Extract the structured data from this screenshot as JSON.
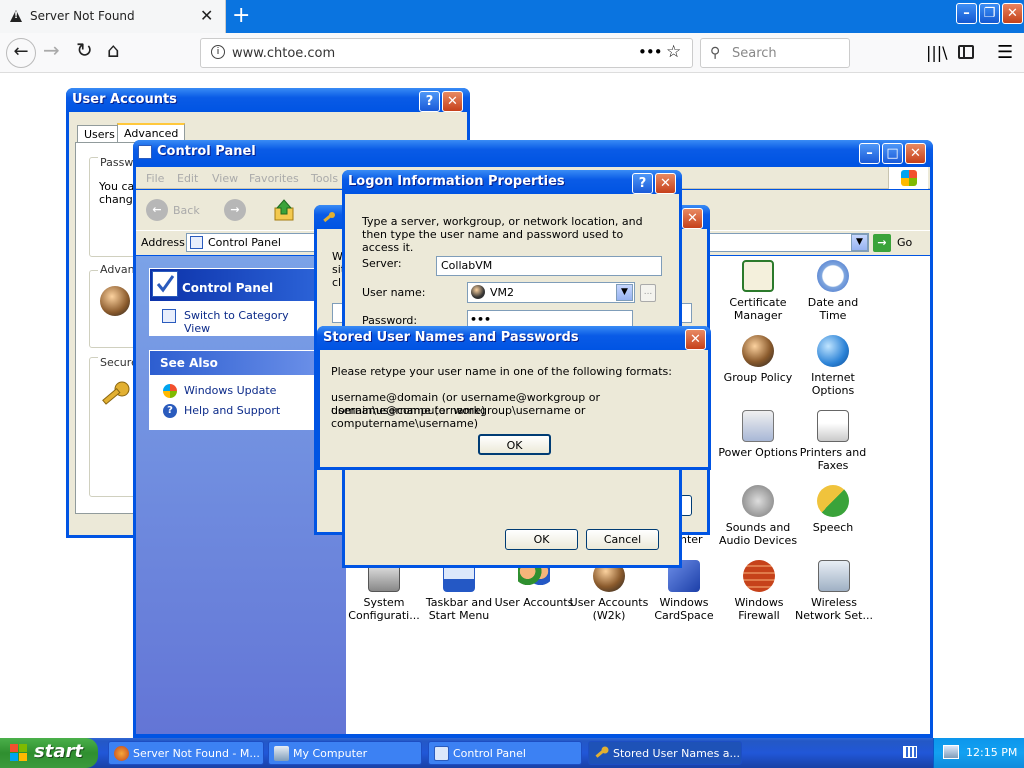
{
  "browser": {
    "tab_title": "Server Not Found",
    "tab_close": "✕",
    "new_tab": "+",
    "url": "www.chtoe.com",
    "search_placeholder": "Search",
    "page_actions": "•••",
    "bookmark_star": "☆",
    "window_min": "–",
    "window_max": "❐",
    "window_close": "✕"
  },
  "user_accounts": {
    "title": "User Accounts",
    "help": "?",
    "close": "✕",
    "tabs": [
      "Users",
      "Advanced"
    ],
    "passwords_group": "Passwo",
    "passwords_text_1": "You ca",
    "passwords_text_2": "change",
    "advanced_group": "Advanc",
    "secure_group": "Secure"
  },
  "control_panel": {
    "title": "Control Panel",
    "menu": [
      "File",
      "Edit",
      "View",
      "Favorites",
      "Tools"
    ],
    "back_label": "Back",
    "address_label": "Address",
    "address_value": "Control Panel",
    "go_label": "Go",
    "panel_title": "Control Panel",
    "switch_view": "Switch to Category View",
    "see_also": "See Also",
    "see_also_items": [
      "Windows Update",
      "Help and Support"
    ],
    "items": [
      {
        "label": "Certificate Manager",
        "icon": "certificate-icon"
      },
      {
        "label": "Date and Time",
        "icon": "clock-icon"
      },
      {
        "label": "Group Policy",
        "icon": "group-policy-icon"
      },
      {
        "label": "Internet Options",
        "icon": "globe-icon"
      },
      {
        "label": "Power Options",
        "icon": "power-icon"
      },
      {
        "label": "Printers and Faxes",
        "icon": "printer-icon"
      },
      {
        "label": "Sounds and Audio Devices",
        "icon": "speaker-icon"
      },
      {
        "label": "Speech",
        "icon": "speech-icon"
      },
      {
        "label": "System Configurati...",
        "icon": "system-icon"
      },
      {
        "label": "Taskbar and Start Menu",
        "icon": "taskbar-icon"
      },
      {
        "label": "User Accounts",
        "icon": "users-icon"
      },
      {
        "label": "User Accounts (W2k)",
        "icon": "users-key-icon"
      },
      {
        "label": "Windows CardSpace",
        "icon": "cardspace-icon"
      },
      {
        "label": "Windows Firewall",
        "icon": "firewall-icon"
      },
      {
        "label": "Wireless Network Set...",
        "icon": "wireless-icon"
      }
    ],
    "partial_text_en": "en",
    "partial_text_nter": "nter",
    "partial_text_w": "W",
    "partial_text_si": "sit",
    "partial_text_cl": "cli"
  },
  "logon": {
    "title": "Logon Information Properties",
    "help": "?",
    "close": "✕",
    "description": "Type a server, workgroup, or network location, and then type the user name and password used to access it.",
    "server_label": "Server:",
    "server_value": "CollabVM",
    "username_label": "User name:",
    "username_value": "VM2",
    "password_label": "Password:",
    "password_value": "•••",
    "ok": "OK",
    "cancel": "Cancel",
    "browse": "..."
  },
  "stored": {
    "title": "Stored User Names and Passwords",
    "close": "✕",
    "line1": "Please retype your user name in one of the following formats:",
    "line2": "username@domain (or username@workgroup or username@computername)",
    "line3": "domain\\username (or workgroup\\username or computername\\username)",
    "ok": "OK"
  },
  "taskbar": {
    "start": "start",
    "items": [
      {
        "label": "Server Not Found - M...",
        "icon": "firefox-icon"
      },
      {
        "label": "My Computer",
        "icon": "computer-icon"
      },
      {
        "label": "Control Panel",
        "icon": "control-panel-icon"
      },
      {
        "label": "Stored User Names a...",
        "icon": "key-icon"
      }
    ],
    "clock": "12:15 PM"
  },
  "colors": {
    "xp_blue": "#0054e3",
    "taskbar_blue": "#2458c5",
    "start_green": "#3c9a3c"
  }
}
